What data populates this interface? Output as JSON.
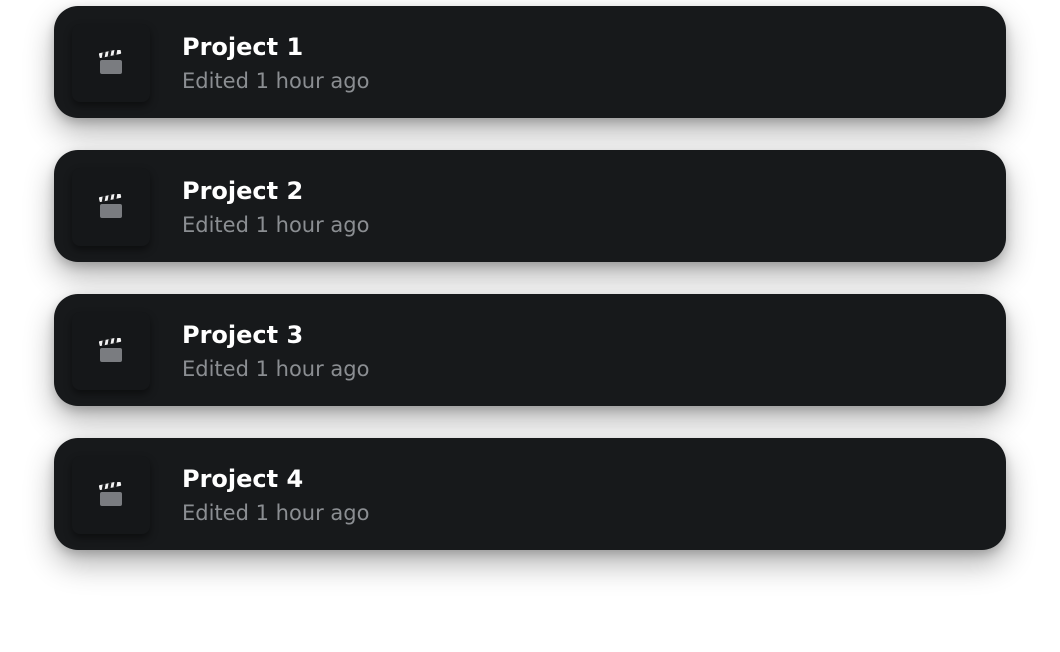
{
  "projects": [
    {
      "title": "Project 1",
      "subtitle": "Edited 1 hour ago",
      "icon": "clapperboard-icon"
    },
    {
      "title": "Project 2",
      "subtitle": "Edited 1 hour ago",
      "icon": "clapperboard-icon"
    },
    {
      "title": "Project 3",
      "subtitle": "Edited 1 hour ago",
      "icon": "clapperboard-icon"
    },
    {
      "title": "Project 4",
      "subtitle": "Edited 1 hour ago",
      "icon": "clapperboard-icon"
    }
  ],
  "colors": {
    "card_background": "#17191b",
    "title_text": "#ffffff",
    "subtitle_text": "#8b8e92",
    "icon": "#7a7c80"
  }
}
